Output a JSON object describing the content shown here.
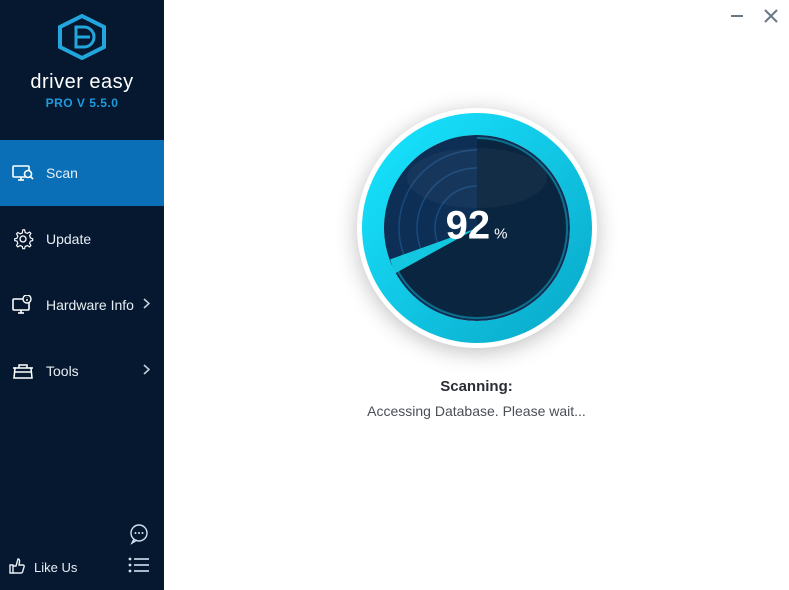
{
  "brand": {
    "name": "driver easy",
    "version_label": "PRO V 5.5.0"
  },
  "sidebar": {
    "items": [
      {
        "label": "Scan",
        "has_sub": false,
        "active": true
      },
      {
        "label": "Update",
        "has_sub": false,
        "active": false
      },
      {
        "label": "Hardware Info",
        "has_sub": true,
        "active": false
      },
      {
        "label": "Tools",
        "has_sub": true,
        "active": false
      }
    ],
    "like_label": "Like Us"
  },
  "scan": {
    "progress_value": "92",
    "progress_unit": "%",
    "status_title": "Scanning:",
    "status_detail": "Accessing Database. Please wait..."
  },
  "colors": {
    "sidebar_bg": "#05182f",
    "accent": "#0a6fb6",
    "gauge_ring": "#0dd1e8",
    "gauge_inner": "#123a69"
  }
}
